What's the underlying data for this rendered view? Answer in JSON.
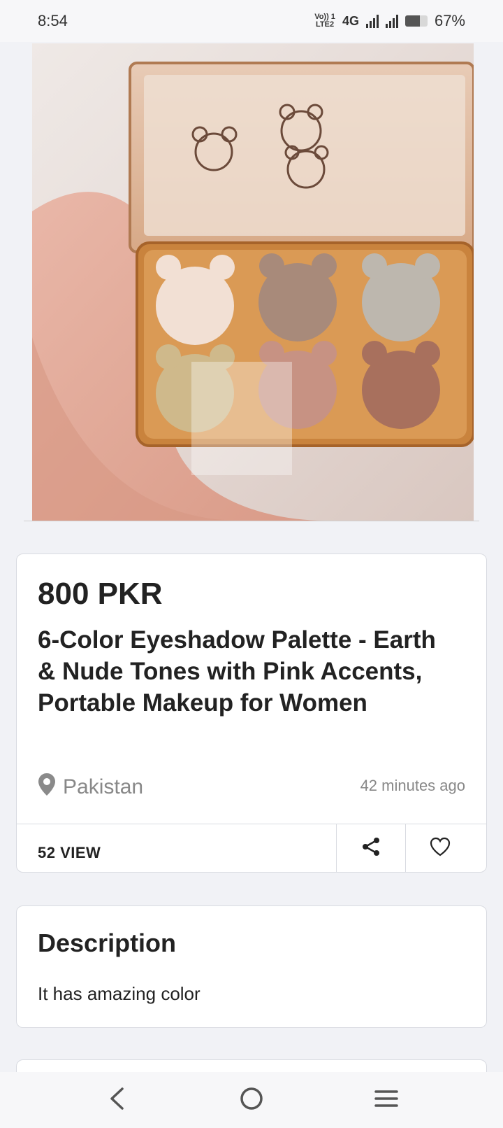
{
  "status_bar": {
    "time": "8:54",
    "lte_label": "Vo)) 1\nLTE2",
    "network": "4G",
    "battery_percent": "67%",
    "battery_level": 0.67
  },
  "product": {
    "image_description_icon": "eyeshadow-palette-image",
    "price": "800 PKR",
    "title": "6-Color Eyeshadow Palette - Earth & Nude Tones with Pink Accents, Portable Makeup for Women",
    "location": "Pakistan",
    "posted": "42 minutes ago",
    "views": "52 VIEW"
  },
  "description": {
    "heading": "Description",
    "text": "It has amazing color"
  },
  "icons": {
    "location": "location-pin-icon",
    "share": "share-icon",
    "favorite": "heart-icon",
    "back": "back-icon",
    "home": "home-icon",
    "menu": "menu-icon"
  },
  "colors": {
    "background": "#f1f2f6",
    "card": "#ffffff",
    "text": "#222222",
    "muted": "#888888"
  }
}
